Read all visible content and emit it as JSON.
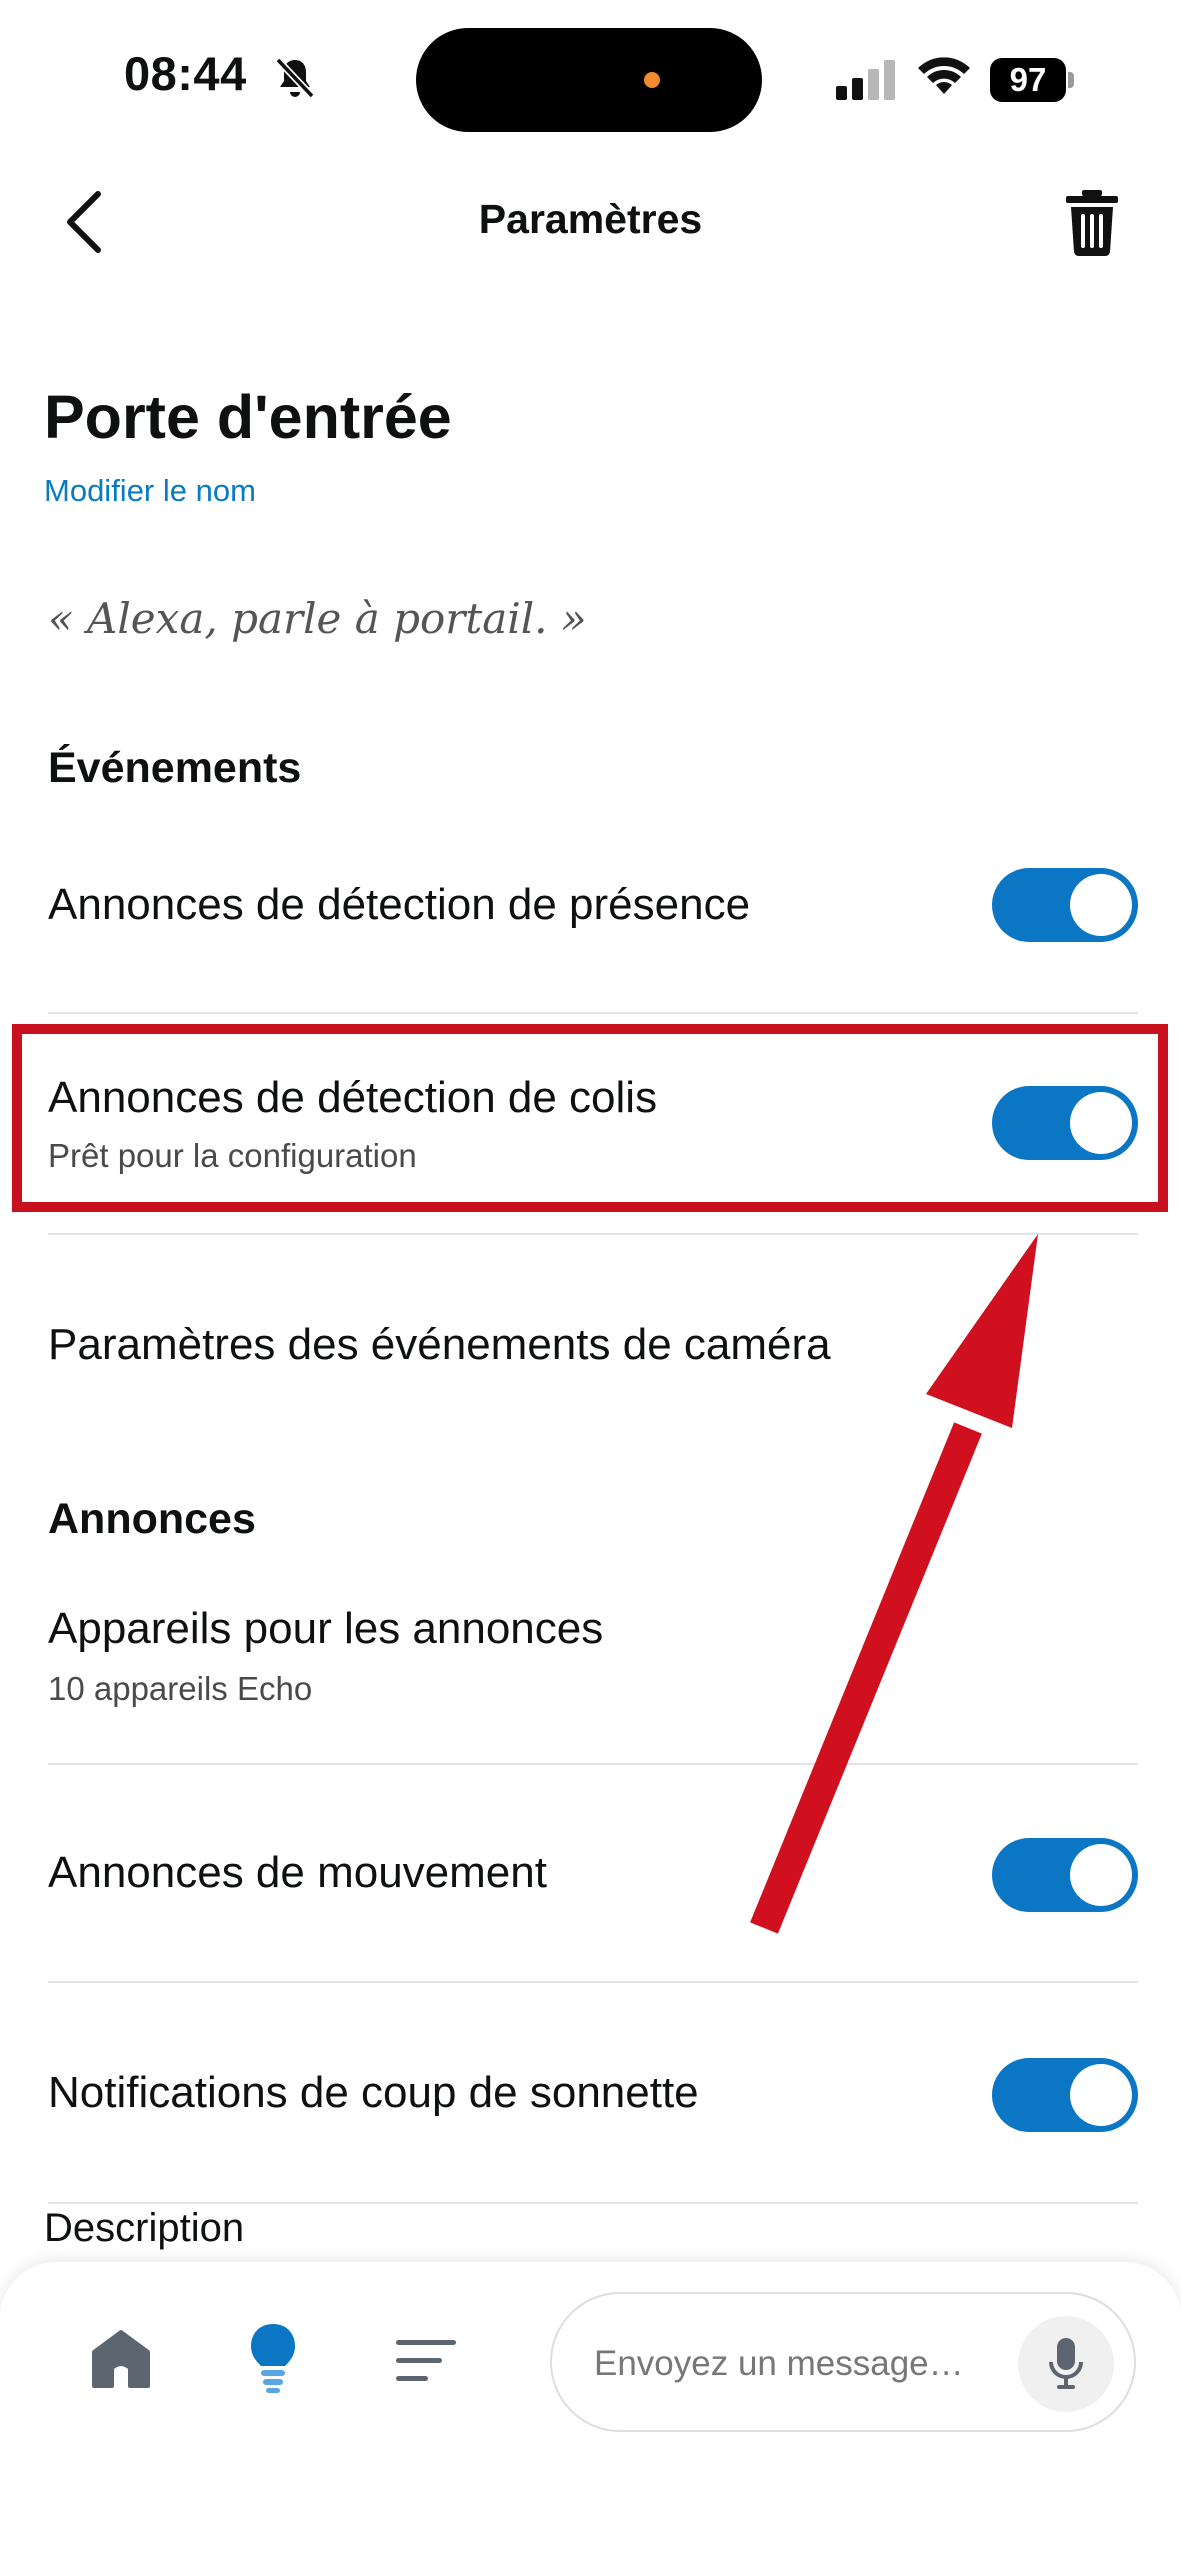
{
  "status_bar": {
    "time": "08:44",
    "battery": "97",
    "icons": [
      "bell-slash-icon",
      "signal-icon",
      "wifi-icon",
      "battery-icon"
    ]
  },
  "header": {
    "title": "Paramètres",
    "back_icon": "chevron-left-icon",
    "delete_icon": "trash-icon"
  },
  "device": {
    "name": "Porte d'entrée",
    "rename_link": "Modifier le nom",
    "alexa_phrase": "« Alexa, parle à portail. »"
  },
  "events": {
    "header": "Événements",
    "items": [
      {
        "title": "Annonces de détection de présence",
        "toggle": true
      },
      {
        "title": "Annonces de détection de colis",
        "subtitle": "Prêt pour la configuration",
        "toggle": true,
        "highlighted": true
      },
      {
        "title": "Paramètres des événements de caméra"
      }
    ]
  },
  "announcements": {
    "header": "Annonces",
    "items": [
      {
        "title": "Appareils pour les annonces",
        "subtitle": "10 appareils Echo"
      },
      {
        "title": "Annonces de mouvement",
        "toggle": true
      },
      {
        "title": "Notifications de coup de sonnette",
        "toggle": true
      }
    ]
  },
  "description_label": "Description",
  "bottom_nav": {
    "icons": [
      "home-icon",
      "devices-lightbulb-icon",
      "more-menu-icon"
    ],
    "message_placeholder": "Envoyez un message…",
    "mic_icon": "microphone-icon"
  },
  "colors": {
    "accent": "#0b76c4",
    "link": "#0b7bc1",
    "highlight": "#c8101e",
    "arrow": "#d0101e"
  }
}
